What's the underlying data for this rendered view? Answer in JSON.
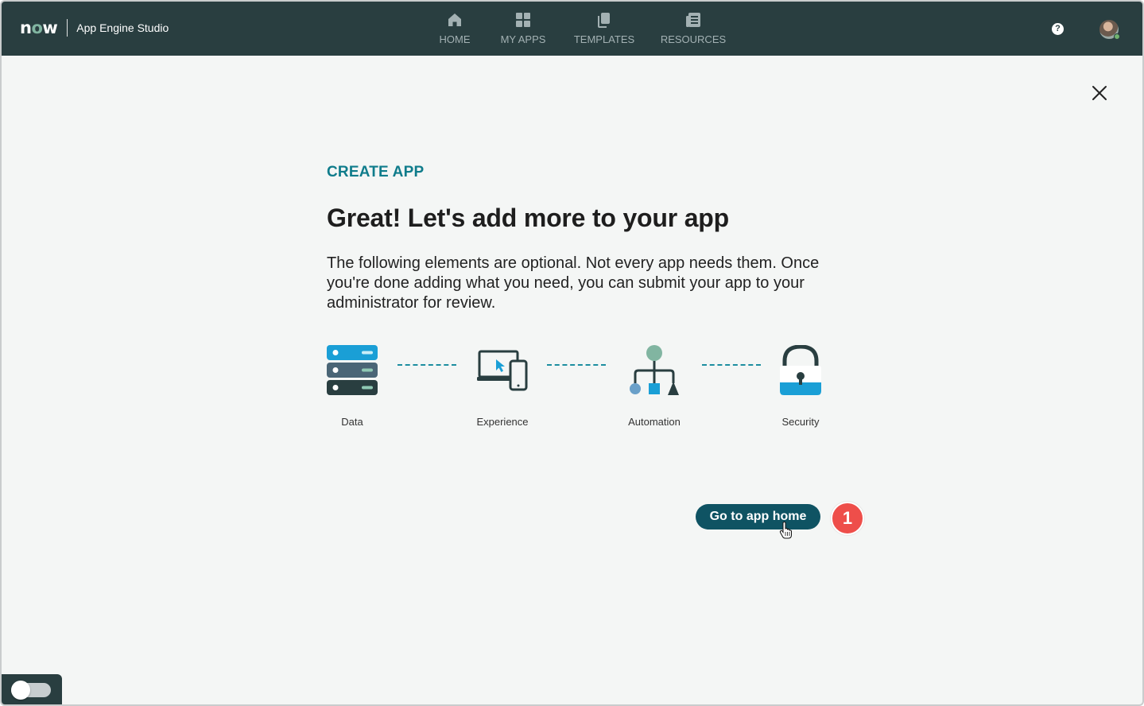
{
  "header": {
    "logo_text": "now",
    "app_name": "App Engine Studio",
    "nav": [
      {
        "label": "HOME",
        "icon": "home-icon"
      },
      {
        "label": "MY APPS",
        "icon": "grid-icon"
      },
      {
        "label": "TEMPLATES",
        "icon": "copy-icon"
      },
      {
        "label": "RESOURCES",
        "icon": "document-icon"
      }
    ],
    "help_glyph": "?"
  },
  "main": {
    "eyebrow": "CREATE APP",
    "title": "Great! Let's add more to your app",
    "description": "The following elements are optional. Not every app needs them. Once you're done adding what you need, you can submit your app to your administrator for review.",
    "steps": [
      {
        "label": "Data",
        "icon": "database-icon"
      },
      {
        "label": "Experience",
        "icon": "devices-icon"
      },
      {
        "label": "Automation",
        "icon": "flow-icon"
      },
      {
        "label": "Security",
        "icon": "lock-icon"
      }
    ],
    "primary_button": "Go to app home",
    "step_badge": "1"
  },
  "colors": {
    "header_bg": "#293e40",
    "accent_teal": "#0f7c8b",
    "button_bg": "#0f5363",
    "badge_red": "#ee4e4a"
  }
}
